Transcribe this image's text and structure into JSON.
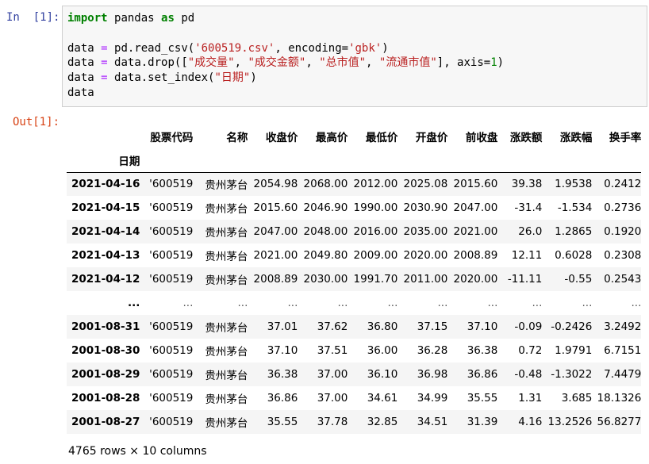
{
  "input_prompt": "In  [1]:",
  "output_prompt": "Out[1]:",
  "code": {
    "line1": {
      "import": "import",
      "module": "pandas",
      "as": "as",
      "alias": "pd"
    },
    "line2": {
      "var": "data",
      "eq": "=",
      "call": "pd.read_csv(",
      "file": "'600519.csv'",
      "mid": ", encoding=",
      "enc": "'gbk'",
      "end": ")"
    },
    "line3": {
      "var": "data",
      "eq": "=",
      "call": "data.drop([",
      "s1": "\"成交量\"",
      "s2": "\"成交金额\"",
      "s3": "\"总市值\"",
      "s4": "\"流通市值\"",
      "mid": "], axis=",
      "axis": "1",
      "end": ")"
    },
    "line4": {
      "var": "data",
      "eq": "=",
      "call": "data.set_index(",
      "s1": "\"日期\"",
      "end": ")"
    },
    "line5": {
      "var": "data"
    }
  },
  "table": {
    "columns": [
      "股票代码",
      "名称",
      "收盘价",
      "最高价",
      "最低价",
      "开盘价",
      "前收盘",
      "涨跌额",
      "涨跌幅",
      "换手率"
    ],
    "index_name": "日期",
    "rows": [
      {
        "index": "2021-04-16",
        "cells": [
          "'600519",
          "贵州茅台",
          "2054.98",
          "2068.00",
          "2012.00",
          "2025.08",
          "2015.60",
          "39.38",
          "1.9538",
          "0.2412"
        ]
      },
      {
        "index": "2021-04-15",
        "cells": [
          "'600519",
          "贵州茅台",
          "2015.60",
          "2046.90",
          "1990.00",
          "2030.90",
          "2047.00",
          "-31.4",
          "-1.534",
          "0.2736"
        ]
      },
      {
        "index": "2021-04-14",
        "cells": [
          "'600519",
          "贵州茅台",
          "2047.00",
          "2048.00",
          "2016.00",
          "2035.00",
          "2021.00",
          "26.0",
          "1.2865",
          "0.1920"
        ]
      },
      {
        "index": "2021-04-13",
        "cells": [
          "'600519",
          "贵州茅台",
          "2021.00",
          "2049.80",
          "2009.00",
          "2020.00",
          "2008.89",
          "12.11",
          "0.6028",
          "0.2308"
        ]
      },
      {
        "index": "2021-04-12",
        "cells": [
          "'600519",
          "贵州茅台",
          "2008.89",
          "2030.00",
          "1991.70",
          "2011.00",
          "2020.00",
          "-11.11",
          "-0.55",
          "0.2543"
        ]
      },
      {
        "index": "...",
        "cells": [
          "...",
          "...",
          "...",
          "...",
          "...",
          "...",
          "...",
          "...",
          "...",
          "..."
        ]
      },
      {
        "index": "2001-08-31",
        "cells": [
          "'600519",
          "贵州茅台",
          "37.01",
          "37.62",
          "36.80",
          "37.15",
          "37.10",
          "-0.09",
          "-0.2426",
          "3.2492"
        ]
      },
      {
        "index": "2001-08-30",
        "cells": [
          "'600519",
          "贵州茅台",
          "37.10",
          "37.51",
          "36.00",
          "36.28",
          "36.38",
          "0.72",
          "1.9791",
          "6.7151"
        ]
      },
      {
        "index": "2001-08-29",
        "cells": [
          "'600519",
          "贵州茅台",
          "36.38",
          "37.00",
          "36.10",
          "36.98",
          "36.86",
          "-0.48",
          "-1.3022",
          "7.4479"
        ]
      },
      {
        "index": "2001-08-28",
        "cells": [
          "'600519",
          "贵州茅台",
          "36.86",
          "37.00",
          "34.61",
          "34.99",
          "35.55",
          "1.31",
          "3.685",
          "18.1326"
        ]
      },
      {
        "index": "2001-08-27",
        "cells": [
          "'600519",
          "贵州茅台",
          "35.55",
          "37.78",
          "32.85",
          "34.51",
          "31.39",
          "4.16",
          "13.2526",
          "56.8277"
        ]
      }
    ]
  },
  "shape_text": "4765 rows × 10 columns"
}
